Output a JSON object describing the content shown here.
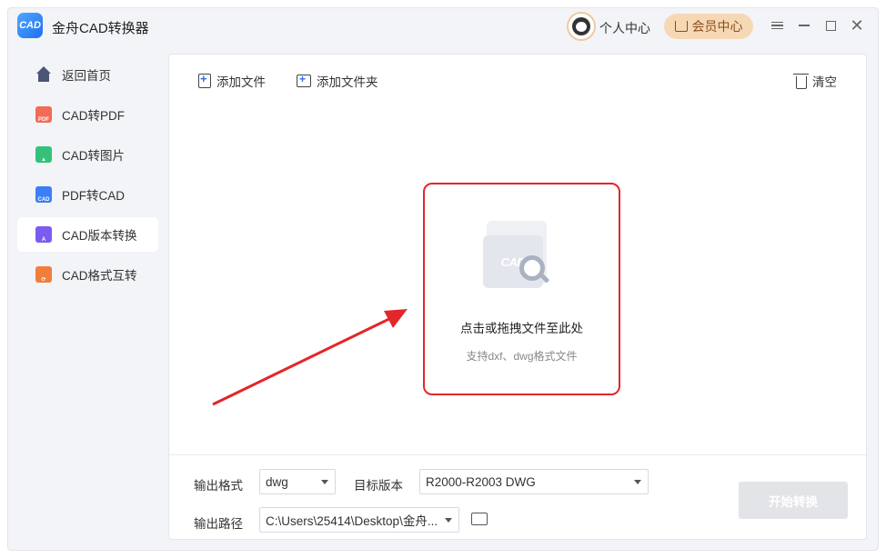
{
  "app": {
    "title": "金舟CAD转换器",
    "logo_text": "CAD",
    "personal_center": "个人中心",
    "member_center": "会员中心"
  },
  "sidebar": {
    "items": [
      {
        "label": "返回首页",
        "icon": "home-icon"
      },
      {
        "label": "CAD转PDF",
        "icon": "pdf-icon"
      },
      {
        "label": "CAD转图片",
        "icon": "image-icon"
      },
      {
        "label": "PDF转CAD",
        "icon": "cad-icon"
      },
      {
        "label": "CAD版本转换",
        "icon": "version-icon",
        "active": true
      },
      {
        "label": "CAD格式互转",
        "icon": "format-convert-icon"
      }
    ]
  },
  "toolbar": {
    "add_file": "添加文件",
    "add_folder": "添加文件夹",
    "clear": "清空"
  },
  "dropzone": {
    "title": "点击或拖拽文件至此处",
    "subtitle": "支持dxf、dwg格式文件",
    "illustration_text": "CAD"
  },
  "settings": {
    "output_format_label": "输出格式",
    "output_format_value": "dwg",
    "target_version_label": "目标版本",
    "target_version_value": "R2000-R2003 DWG",
    "output_path_label": "输出路径",
    "output_path_value": "C:\\Users\\25414\\Desktop\\金舟...",
    "start_button": "开始转换"
  },
  "colors": {
    "accent_red": "#e3262a",
    "member_bg": "#f6d8b5",
    "disabled_button": "#e3e4e7"
  }
}
